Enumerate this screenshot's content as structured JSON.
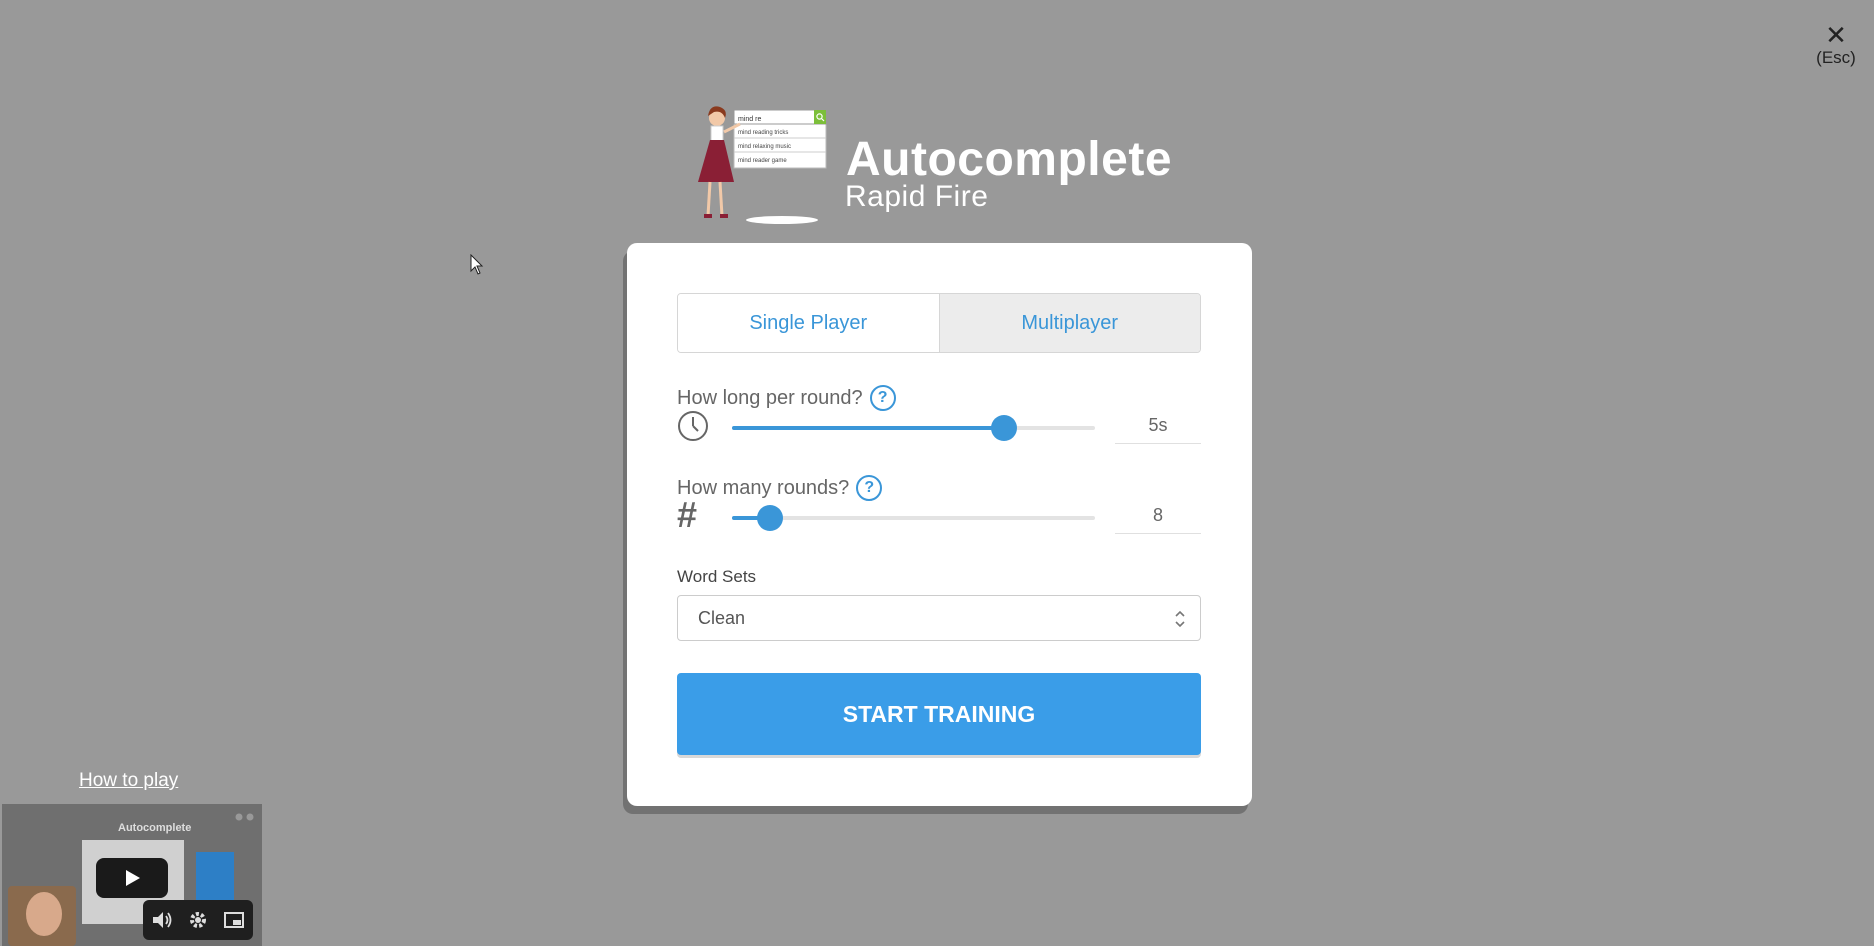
{
  "close": {
    "icon": "close-icon",
    "label": "(Esc)"
  },
  "logo": {
    "title": "Autocomplete",
    "subtitle": "Rapid Fire",
    "search_text": "mind re",
    "suggestions": [
      "mind reading tricks",
      "mind relaxing music",
      "mind reader game"
    ]
  },
  "tabs": [
    {
      "label": "Single Player",
      "active": true
    },
    {
      "label": "Multiplayer",
      "active": false
    }
  ],
  "round_length": {
    "question": "How long per round?",
    "help": "?",
    "icon": "clock-icon",
    "value": "5s",
    "slider_fraction": 0.75
  },
  "rounds": {
    "question": "How many rounds?",
    "help": "?",
    "icon": "hash-icon",
    "icon_glyph": "#",
    "value": "8",
    "slider_fraction": 0.105
  },
  "word_sets": {
    "label": "Word Sets",
    "selected": "Clean"
  },
  "start_button": "START TRAINING",
  "how_to_play": "How to play",
  "video": {
    "title": "Autocomplete",
    "card_button": "Start",
    "controls": [
      "volume-icon",
      "gear-icon",
      "pip-icon"
    ]
  },
  "colors": {
    "accent": "#3a96d8",
    "button": "#3a9de8",
    "overlay": "#999999"
  }
}
